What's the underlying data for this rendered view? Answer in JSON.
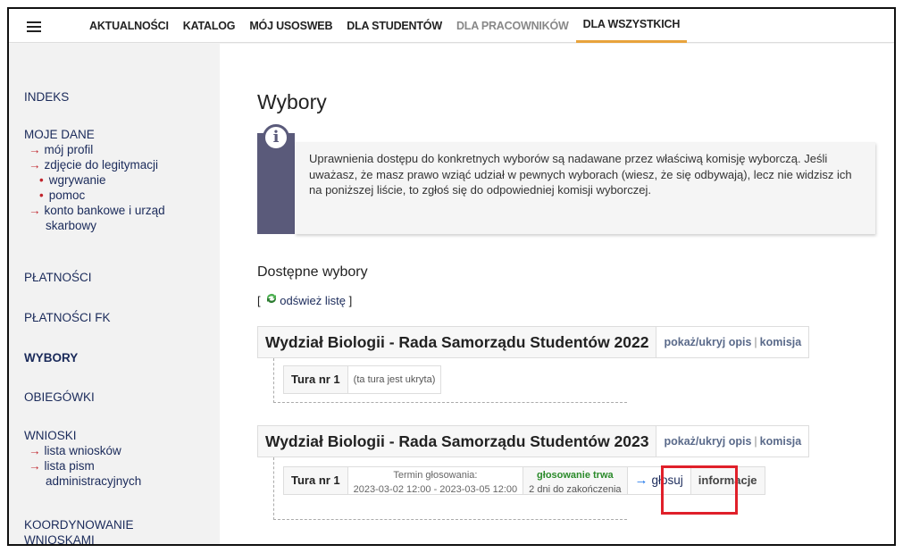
{
  "topnav": {
    "items": [
      "AKTUALNOŚCI",
      "KATALOG",
      "MÓJ USOSWEB",
      "DLA STUDENTÓW",
      "DLA PRACOWNIKÓW",
      "DLA WSZYSTKICH"
    ],
    "active": "DLA WSZYSTKICH",
    "accent": "#e8a33c"
  },
  "sidebar": {
    "indeks": "INDEKS",
    "moje_dane": "MOJE DANE",
    "moj_profil": "mój profil",
    "zdjecie": "zdjęcie do legitymacji",
    "wgrywanie": "wgrywanie",
    "pomoc": "pomoc",
    "konto1": "konto bankowe i urząd",
    "konto2": "skarbowy",
    "platnosci": "PŁATNOŚCI",
    "platnosci_fk": "PŁATNOŚCI FK",
    "wybory": "WYBORY",
    "obiegowki": "OBIEGÓWKI",
    "wnioski": "WNIOSKI",
    "lista_wnioskow": "lista wniosków",
    "lista_pism1": "lista pism",
    "lista_pism2": "administracyjnych",
    "koord1": "KOORDYNOWANIE",
    "koord2": "WNIOSKAMI"
  },
  "main": {
    "title": "Wybory",
    "info": "Uprawnienia dostępu do konkretnych wyborów są nadawane przez właściwą komisję wyborczą. Jeśli uważasz, że masz prawo wziąć udział w pewnych wyborach (wiesz, że się odbywają), lecz nie widzisz ich na poniższej liście, to zgłoś się do odpowiedniej komisji wyborczej.",
    "subtitle": "Dostępne wybory",
    "refresh_open": "[",
    "refresh_label": "odśwież listę",
    "refresh_close": "]"
  },
  "elections": [
    {
      "title": "Wydział Biologii - Rada Samorządu Studentów 2022",
      "toggle": "pokaż/ukryj opis",
      "sep": "|",
      "commission": "komisja",
      "round": "Tura nr 1",
      "hidden_note": "(ta tura jest ukryta)"
    },
    {
      "title": "Wydział Biologii - Rada Samorządu Studentów 2023",
      "toggle": "pokaż/ukryj opis",
      "sep": "|",
      "commission": "komisja",
      "round": "Tura nr 1",
      "term_label": "Termin głosowania:",
      "term_value": "2023-03-02 12:00 - 2023-03-05 12:00",
      "status": "głosowanie trwa",
      "remaining": "2 dni do zakończenia",
      "vote_label": "głosuj",
      "info_label": "informacje"
    }
  ],
  "colors": {
    "info_icon_bg": "#5a5a7a",
    "highlight": "#e0202a",
    "status_green": "#2a8a2a",
    "link_red_arrow": "#c0242c"
  }
}
